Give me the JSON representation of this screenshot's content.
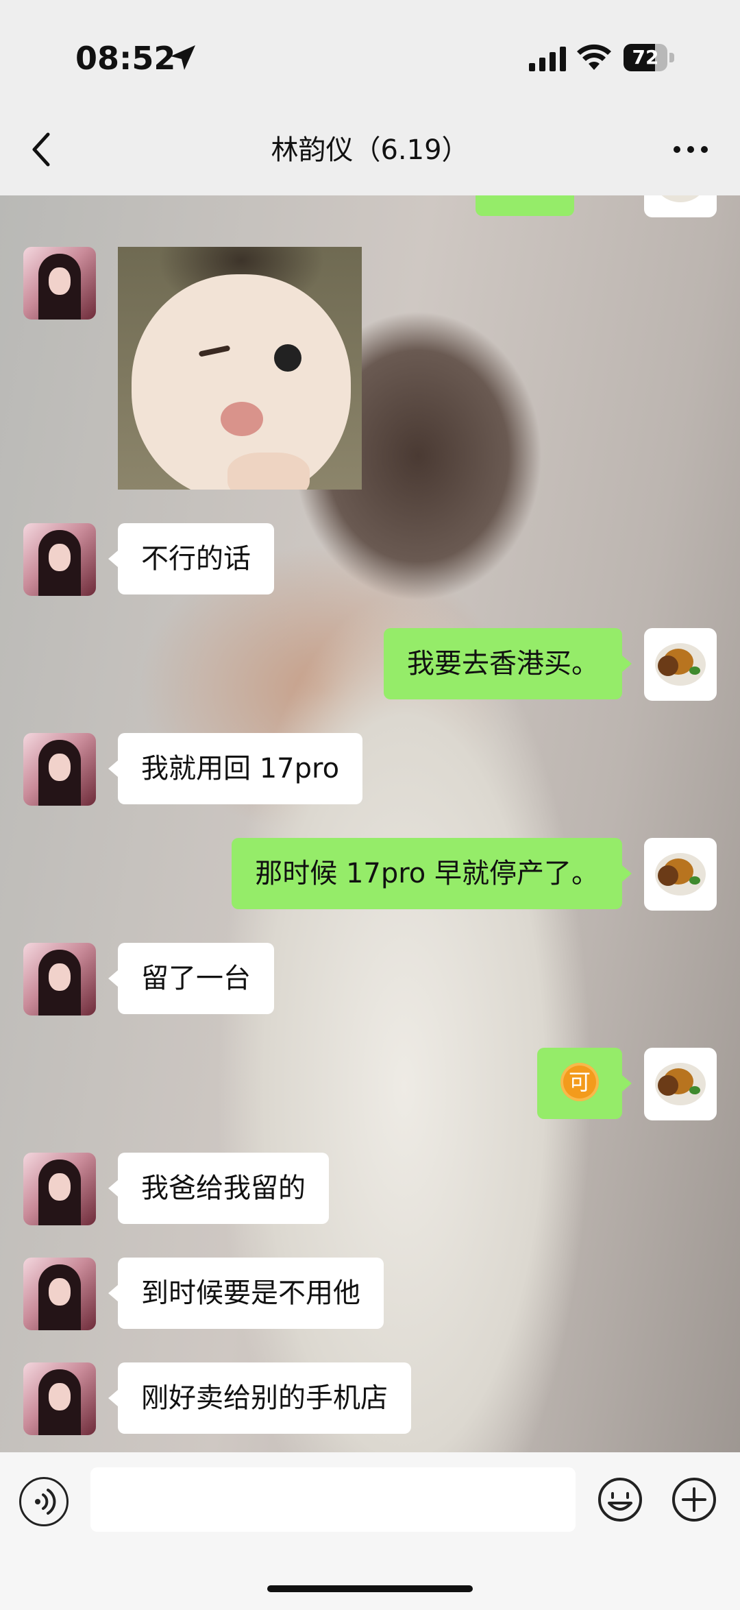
{
  "status_bar": {
    "time": "08:52",
    "battery": "72",
    "battery_level": 0.72
  },
  "header": {
    "title": "林韵仪（6.19）",
    "back_icon": "chevron-left-icon",
    "more_icon": "more-dots-icon"
  },
  "messages": [
    {
      "side": "right",
      "type": "text",
      "text": ""
    },
    {
      "side": "left",
      "type": "sticker",
      "description": "winking-baby-sticker"
    },
    {
      "side": "left",
      "type": "text",
      "text": "不行的话"
    },
    {
      "side": "right",
      "type": "text",
      "text": "我要去香港买。"
    },
    {
      "side": "left",
      "type": "text",
      "text": "我就用回 17pro"
    },
    {
      "side": "right",
      "type": "text",
      "text": "那时候 17pro 早就停产了。"
    },
    {
      "side": "left",
      "type": "text",
      "text": "留了一台"
    },
    {
      "side": "right",
      "type": "emoji",
      "text": "可"
    },
    {
      "side": "left",
      "type": "text",
      "text": "我爸给我留的"
    },
    {
      "side": "left",
      "type": "text",
      "text": "到时候要是不用他"
    },
    {
      "side": "left",
      "type": "text",
      "text": "刚好卖给别的手机店"
    }
  ],
  "input_bar": {
    "voice_icon": "voice-icon",
    "emoji_icon": "emoji-icon",
    "plus_icon": "plus-icon",
    "placeholder": ""
  },
  "colors": {
    "out_bubble": "#95ec69",
    "in_bubble": "#ffffff",
    "bar_bg": "#eeeeee"
  }
}
